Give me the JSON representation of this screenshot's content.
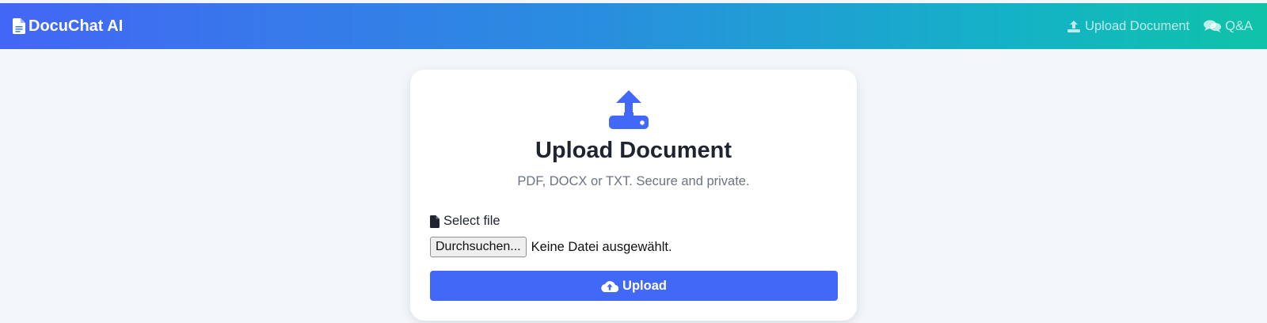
{
  "navbar": {
    "brand": "DocuChat AI",
    "brand_icon": "file-text-icon",
    "links": [
      {
        "label": "Upload Document",
        "icon": "upload-icon"
      },
      {
        "label": "Q&A",
        "icon": "chat-bubbles-icon"
      }
    ]
  },
  "upload_card": {
    "icon": "upload-drive-icon",
    "title": "Upload Document",
    "subtitle": "PDF, DOCX or TXT. Secure and private.",
    "file_label": "Select file",
    "file_label_icon": "file-icon",
    "browse_label": "Durchsuchen...",
    "file_status": "Keine Datei ausgewählt.",
    "submit_label": "Upload",
    "submit_icon": "cloud-upload-icon"
  },
  "colors": {
    "gradient_start": "#4366f5",
    "gradient_end": "#0fc3a8",
    "primary": "#4268f7",
    "page_bg": "#f3f6fa"
  }
}
